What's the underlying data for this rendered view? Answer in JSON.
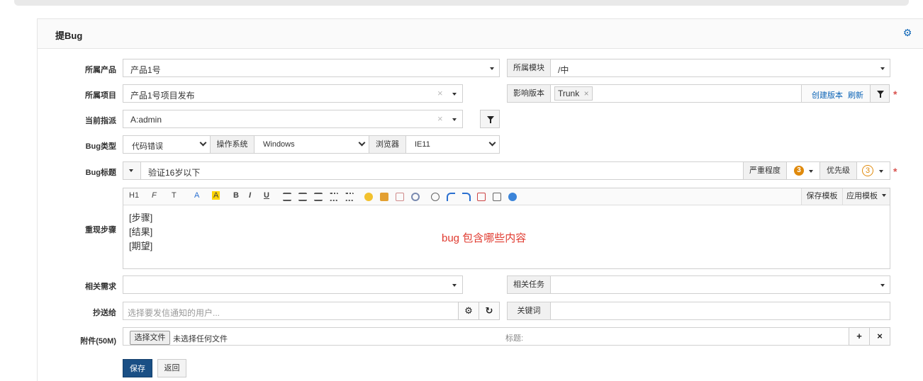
{
  "panel": {
    "title": "提Bug"
  },
  "form": {
    "product": {
      "label": "所属产品",
      "value": "产品1号"
    },
    "module": {
      "label": "所属模块",
      "value": "/中"
    },
    "project": {
      "label": "所属项目",
      "value": "产品1号项目发布"
    },
    "build": {
      "label": "影响版本",
      "tag": "Trunk",
      "create_link": "创建版本",
      "refresh_link": "刷新"
    },
    "assigned": {
      "label": "当前指派",
      "value": "A:admin"
    },
    "bugtype": {
      "label": "Bug类型",
      "value": "代码错误"
    },
    "os": {
      "label": "操作系统",
      "value": "Windows"
    },
    "browser": {
      "label": "浏览器",
      "value": "IE11"
    },
    "title": {
      "label": "Bug标题",
      "value": "验证16岁以下"
    },
    "severity": {
      "label": "严重程度",
      "value": "3"
    },
    "priority": {
      "label": "优先级",
      "value": "3"
    },
    "steps": {
      "label": "重现步骤",
      "lines": [
        "[步骤]",
        "[结果]",
        "[期望]"
      ],
      "annotation": "bug 包含哪些内容"
    },
    "story": {
      "label": "相关需求",
      "value": ""
    },
    "task": {
      "label": "相关任务",
      "value": ""
    },
    "mailto": {
      "label": "抄送给",
      "placeholder": "选择要发信通知的用户..."
    },
    "keywords": {
      "label": "关键词",
      "value": ""
    },
    "files": {
      "label": "附件(50M)",
      "choose": "选择文件",
      "none": "未选择任何文件",
      "title_placeholder": "标题:"
    }
  },
  "editor": {
    "toolbar": [
      "H1",
      "F",
      "T",
      "A",
      "A",
      "B",
      "I",
      "U"
    ],
    "save_template": "保存模板",
    "apply_template": "应用模板"
  },
  "actions": {
    "save": "保存",
    "back": "返回"
  }
}
